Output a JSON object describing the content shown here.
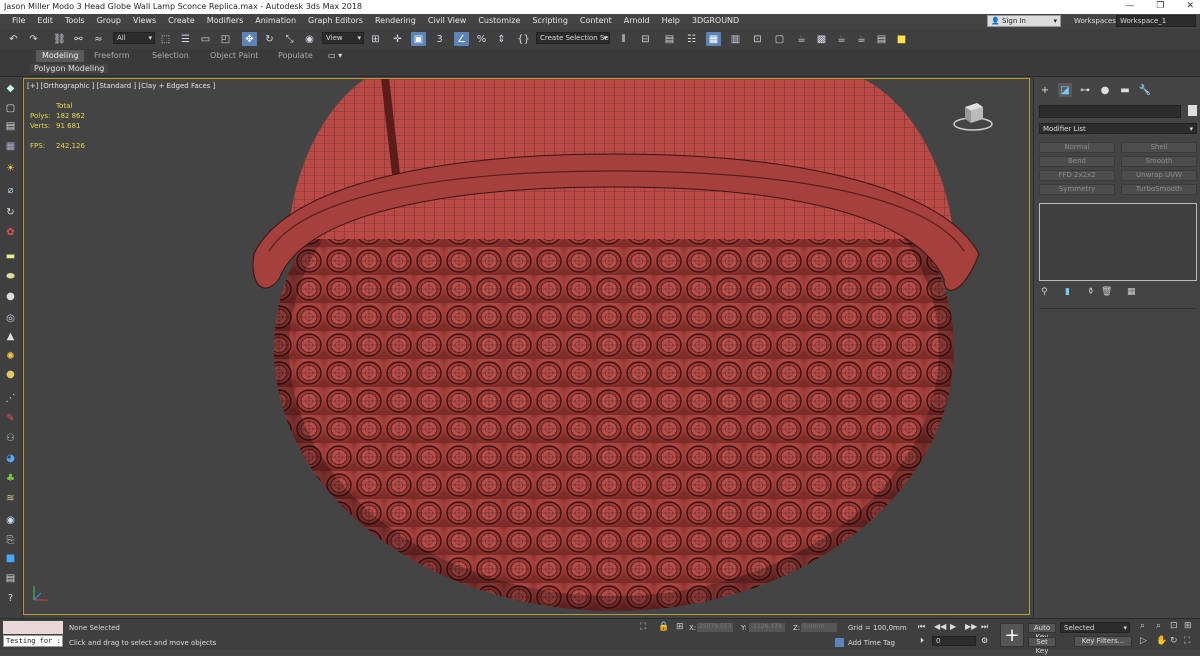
{
  "window": {
    "title": "Jason Miller Modo 3 Head Globe Wall Lamp Sconce Replica.max - Autodesk 3ds Max 2018",
    "minimize": "—",
    "maximize": "❐",
    "close": "✕"
  },
  "menubar": {
    "items": [
      "File",
      "Edit",
      "Tools",
      "Group",
      "Views",
      "Create",
      "Modifiers",
      "Animation",
      "Graph Editors",
      "Rendering",
      "Civil View",
      "Customize",
      "Scripting",
      "Content",
      "Arnold",
      "Help",
      "3DGROUND"
    ],
    "signin": "Sign In",
    "workspaces_label": "Workspaces:",
    "workspace_value": "Workspace_1"
  },
  "toolbar": {
    "filter_value": "All",
    "refcoord_value": "View",
    "selection_set_value": "Create Selection Se"
  },
  "ribbon": {
    "tabs": [
      "Modeling",
      "Freeform",
      "Selection",
      "Object Paint",
      "Populate"
    ],
    "active_tab": "Modeling",
    "sub_label": "Polygon Modeling"
  },
  "viewport": {
    "label": "[+] [Orthographic ] [Standard ] [Clay + Edged Faces ]",
    "stats": {
      "header": "Total",
      "polys_label": "Polys:",
      "polys_value": "182 862",
      "verts_label": "Verts:",
      "verts_value": "91 681",
      "fps_label": "FPS:",
      "fps_value": "242,126"
    },
    "colors": {
      "lamp": "#b84a46",
      "wire": "#3a1514",
      "background": "#444444",
      "border": "#b89a3a"
    }
  },
  "command_panel": {
    "modifier_list": "Modifier List",
    "buttons": [
      "Normal",
      "Shell",
      "Bend",
      "Smooth",
      "FFD 2x2x2",
      "Unwrap UVW",
      "Symmetry",
      "TurboSmooth"
    ]
  },
  "statusbar": {
    "maxscript_value": "Testing for :",
    "selection_status": "None Selected",
    "prompt": "Click and drag to select and move objects",
    "x_label": "X:",
    "x_value": "25879,553",
    "y_label": "Y:",
    "y_value": "-1126,478",
    "z_label": "Z:",
    "z_value": "0,0mm",
    "grid": "Grid = 100,0mm",
    "add_time_tag": "Add Time Tag",
    "frame_value": "0",
    "auto_key": "Auto Key",
    "set_key": "Set Key",
    "selected_value": "Selected",
    "key_filters": "Key Filters..."
  }
}
